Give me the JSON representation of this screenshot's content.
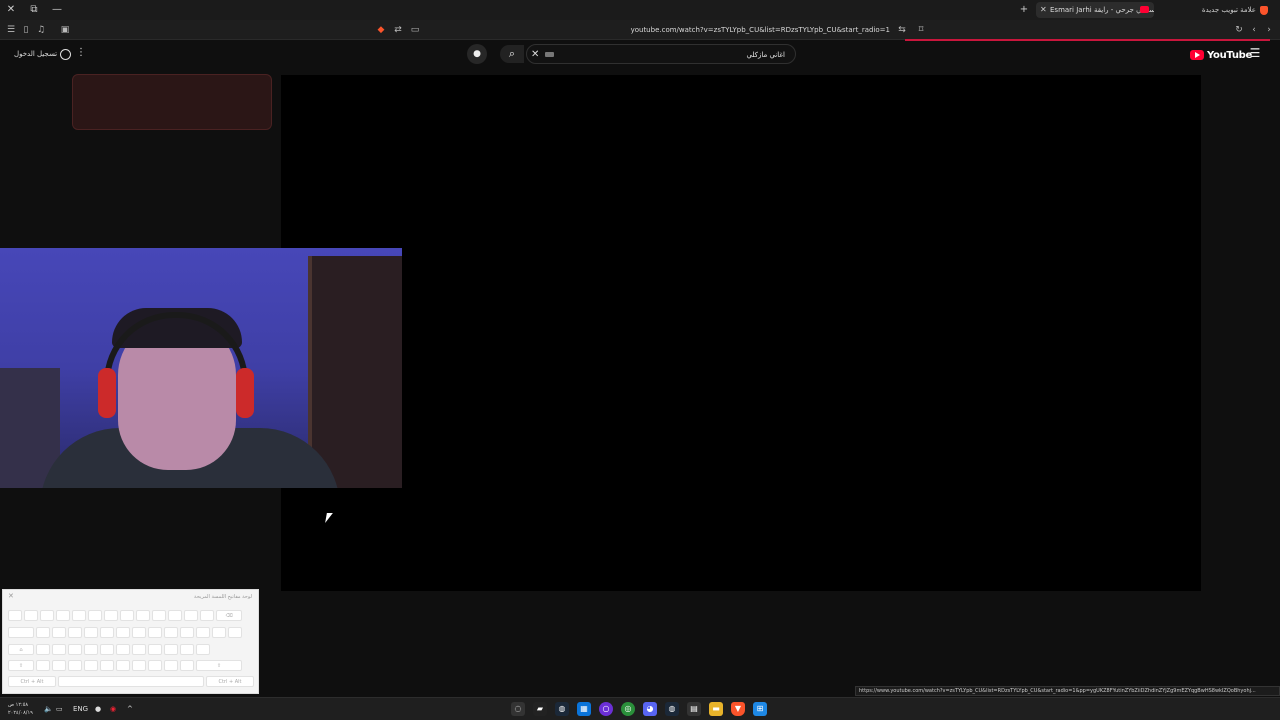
{
  "browser": {
    "tabs": [
      {
        "label": "Esmari Jarhi إسمعي جرحي - رايقة",
        "active": true
      },
      {
        "label": "علامة تبويب جديدة",
        "active": false
      }
    ],
    "address": "youtube.com/watch?v=zsTYLYpb_CU&list=RDzsTYLYpb_CU&start_radio=1",
    "accent_color": "#c9163c"
  },
  "youtube": {
    "logo_text": "YouTube",
    "search_query": "اغاني مازكلي",
    "signin_label": "تسجيل الدخول"
  },
  "keyboard": {
    "title": "لوحة مفاتيح اللمسة المريحة",
    "ctrl_alt_left": "Ctrl + Alt",
    "ctrl_alt_right": "Ctrl + Alt"
  },
  "status_url": "https://www.youtube.com/watch?v=zsTYLYpb_CU&list=RDzsTYLYpb_CU&start_radio=1&pp=ygUKZ8FYutinZYbZiiDZhdinZYjZg9mEZYqgBwHS8wkIZQoBhyohj...",
  "taskbar": {
    "language": "ENG",
    "time": "١٢:٥٨ ص",
    "date": "٢٠٢٤/٠٨/١٩"
  }
}
